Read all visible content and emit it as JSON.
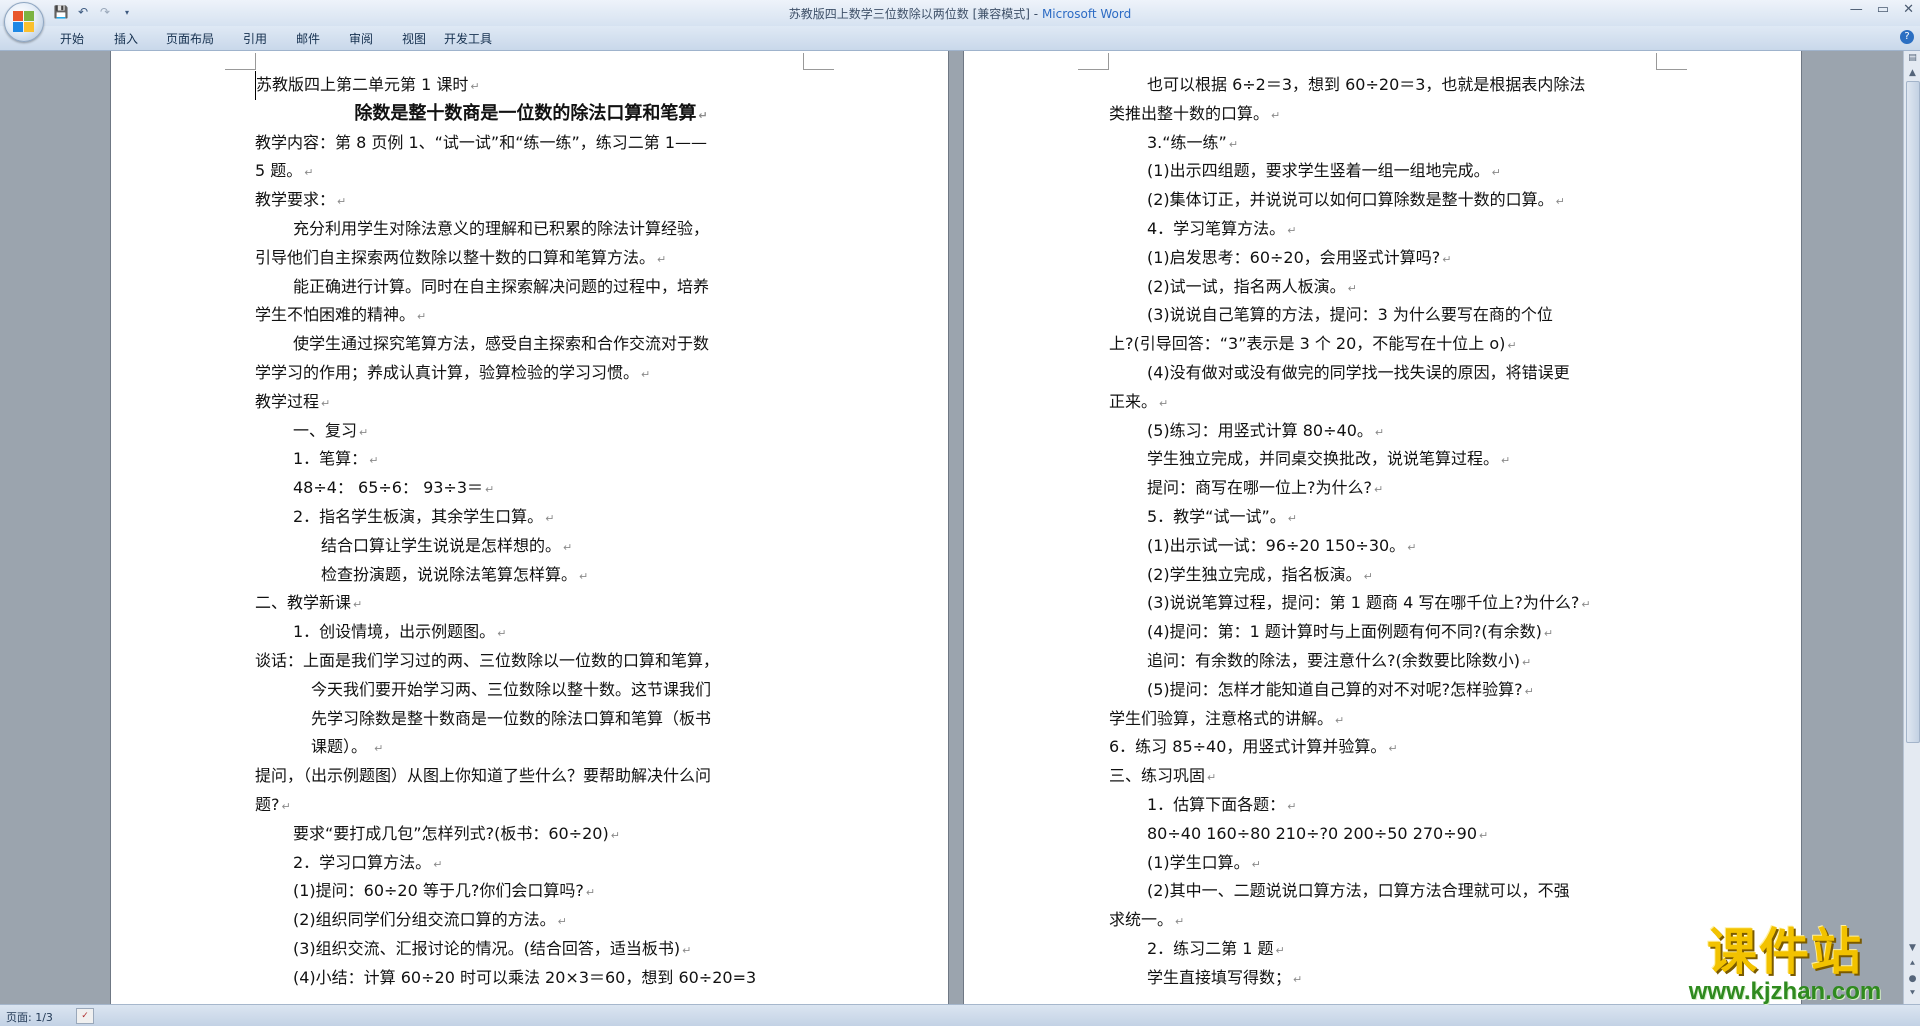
{
  "window": {
    "title_doc": "苏教版四上数学三位数除以两位数 [兼容模式]",
    "title_sep": " - ",
    "title_app": "Microsoft Word",
    "controls": [
      "—",
      "▭",
      "✕"
    ]
  },
  "quick_access": [
    "save-icon",
    "undo-icon",
    "redo-icon",
    "customize-icon"
  ],
  "ribbon": {
    "tabs": [
      "开始",
      "插入",
      "页面布局",
      "引用",
      "邮件",
      "审阅",
      "视图",
      "开发工具"
    ]
  },
  "left_page": {
    "lines": [
      {
        "text": "苏教版四上第二单元第 1 课时",
        "cls": "cursor-line"
      },
      {
        "text": "除数是整十数商是一位数的除法口算和笔算",
        "cls": "ttl"
      },
      {
        "text": "教学内容：第 8 页例 1、“试一试”和“练一练”，练习二第 1——",
        "cls": "",
        "nomark": true
      },
      {
        "text": "5 题。",
        "cls": ""
      },
      {
        "text": "教学要求：",
        "cls": ""
      },
      {
        "text": "充分利用学生对除法意义的理解和已积累的除法计算经验，",
        "cls": "ind1",
        "nomark": true
      },
      {
        "text": "引导他们自主探索两位数除以整十数的口算和笔算方法。",
        "cls": ""
      },
      {
        "text": "能正确进行计算。同时在自主探索解决问题的过程中，培养",
        "cls": "ind1",
        "nomark": true
      },
      {
        "text": "学生不怕困难的精神。",
        "cls": ""
      },
      {
        "text": "使学生通过探究笔算方法，感受自主探索和合作交流对于数",
        "cls": "ind1",
        "nomark": true
      },
      {
        "text": "学学习的作用；养成认真计算，验算检验的学习习惯。",
        "cls": ""
      },
      {
        "text": "教学过程",
        "cls": ""
      },
      {
        "text": "一、复习",
        "cls": "ind1"
      },
      {
        "text": "1．笔算：",
        "cls": "ind1"
      },
      {
        "text": "48÷4：      65÷6：      93÷3＝",
        "cls": "ind1"
      },
      {
        "text": "2．指名学生板演，其余学生口算。",
        "cls": "ind1"
      },
      {
        "text": "结合口算让学生说说是怎样想的。",
        "cls": "ind2"
      },
      {
        "text": "检查扮演题，说说除法笔算怎样算。",
        "cls": "ind2"
      },
      {
        "text": "二、教学新课",
        "cls": ""
      },
      {
        "text": "1．创设情境，出示例题图。",
        "cls": "ind1"
      },
      {
        "text": "谈话：上面是我们学习过的两、三位数除以一位数的口算和笔算，",
        "cls": "",
        "nomark": true
      },
      {
        "text": "今天我们要开始学习两、三位数除以整十数。这节课我们",
        "cls": "hang",
        "nomark": true
      },
      {
        "text": "先学习除数是整十数商是一位数的除法口算和笔算（板书",
        "cls": "hang",
        "nomark": true
      },
      {
        "text": "课题）。        ",
        "cls": "hang"
      },
      {
        "text": "提问，（出示例题图）从图上你知道了些什么？要帮助解决什么问",
        "cls": "",
        "nomark": true
      },
      {
        "text": "题?",
        "cls": ""
      },
      {
        "text": "要求“要打成几包”怎样列式?(板书：60÷20)",
        "cls": "ind1"
      },
      {
        "text": "2．学习口算方法。",
        "cls": "ind1"
      },
      {
        "text": "(1)提问：60÷20 等于几?你们会口算吗?",
        "cls": "ind1"
      },
      {
        "text": "(2)组织同学们分组交流口算的方法。",
        "cls": "ind1"
      },
      {
        "text": "(3)组织交流、汇报讨论的情况。(结合回答，适当板书)",
        "cls": "ind1"
      },
      {
        "text": "(4)小结：计算 60÷20 时可以乘法 20×3＝60，想到 60÷20=3",
        "cls": "ind1",
        "nomark": true
      }
    ]
  },
  "right_page": {
    "lines": [
      {
        "text": "也可以根据 6÷2＝3，想到 60÷20＝3，也就是根据表内除法",
        "cls": "ind1",
        "nomark": true
      },
      {
        "text": "类推出整十数的口算。",
        "cls": ""
      },
      {
        "text": "3.“练一练”",
        "cls": "ind1"
      },
      {
        "text": "(1)出示四组题，要求学生竖着一组一组地完成。",
        "cls": "ind1"
      },
      {
        "text": "(2)集体订正，并说说可以如何口算除数是整十数的口算。",
        "cls": "ind1"
      },
      {
        "text": "4．学习笔算方法。",
        "cls": "ind1"
      },
      {
        "text": "(1)启发思考：60÷20，会用竖式计算吗?",
        "cls": "ind1"
      },
      {
        "text": "(2)试一试，指名两人板演。",
        "cls": "ind1"
      },
      {
        "text": "(3)说说自己笔算的方法，提问：3 为什么要写在商的个位",
        "cls": "ind1",
        "nomark": true
      },
      {
        "text": "上?(引导回答：“3”表示是 3 个 20，不能写在十位上 o)",
        "cls": ""
      },
      {
        "text": "(4)没有做对或没有做完的同学找一找失误的原因，将错误更",
        "cls": "ind1",
        "nomark": true
      },
      {
        "text": "正来。",
        "cls": ""
      },
      {
        "text": "(5)练习：用竖式计算 80÷40。",
        "cls": "ind1"
      },
      {
        "text": "学生独立完成，并同桌交换批改，说说笔算过程。",
        "cls": "ind1"
      },
      {
        "text": "提问：商写在哪一位上?为什么?",
        "cls": "ind1"
      },
      {
        "text": "5．教学“试一试”。",
        "cls": "ind1"
      },
      {
        "text": "(1)出示试一试：96÷20   150÷30。",
        "cls": "ind1"
      },
      {
        "text": "(2)学生独立完成，指名板演。",
        "cls": "ind1"
      },
      {
        "text": "(3)说说笔算过程，提问：第 1 题商 4 写在哪千位上?为什么?",
        "cls": "ind1"
      },
      {
        "text": "(4)提问：第：1 题计算时与上面例题有何不同?(有余数)",
        "cls": "ind1"
      },
      {
        "text": "追问：有余数的除法，要注意什么?(余数要比除数小)",
        "cls": "ind1"
      },
      {
        "text": "(5)提问：怎样才能知道自己算的对不对呢?怎样验算?",
        "cls": "ind1"
      },
      {
        "text": "学生们验算，注意格式的讲解。",
        "cls": ""
      },
      {
        "text": "6．练习 85÷40，用竖式计算并验算。",
        "cls": ""
      },
      {
        "text": "三、练习巩固",
        "cls": ""
      },
      {
        "text": "1．估算下面各题：",
        "cls": "ind1"
      },
      {
        "text": "80÷40     160÷80     210÷?0     200÷50     270÷90",
        "cls": "ind1"
      },
      {
        "text": "(1)学生口算。",
        "cls": "ind1"
      },
      {
        "text": "(2)其中一、二题说说口算方法，口算方法合理就可以，不强",
        "cls": "ind1",
        "nomark": true
      },
      {
        "text": "求统一。",
        "cls": ""
      },
      {
        "text": "2．练习二第 1 题",
        "cls": "ind1"
      },
      {
        "text": "学生直接填写得数；",
        "cls": "ind1"
      }
    ]
  },
  "paragraph_mark": "↵",
  "statusbar": {
    "page_label": "页面: 1/3"
  },
  "watermark": {
    "name": "课件站",
    "url": "www.kjzhan.com"
  }
}
